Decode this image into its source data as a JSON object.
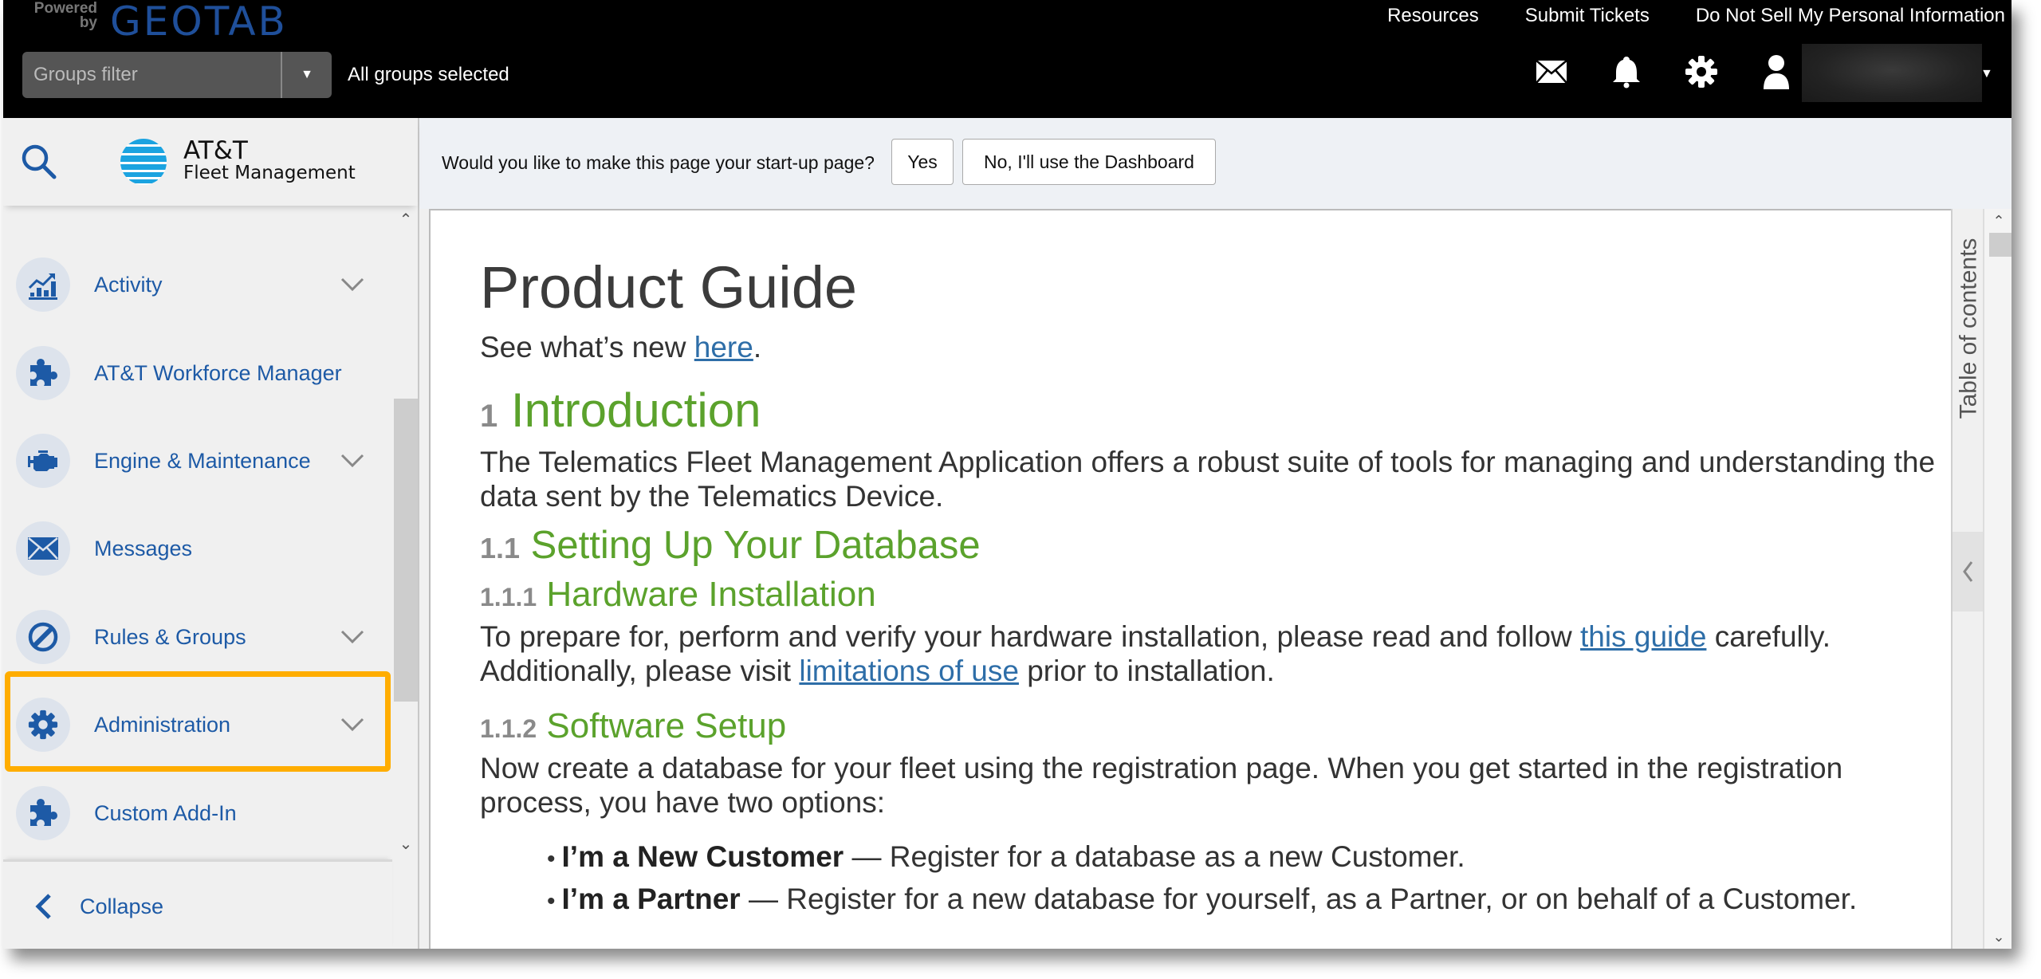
{
  "header": {
    "powered_by": [
      "Powered",
      "by"
    ],
    "brand": "GEOTAB",
    "top_links": [
      "Resources",
      "Submit Tickets",
      "Do Not Sell My Personal Information"
    ],
    "groups_filter": {
      "placeholder": "Groups filter",
      "value": ""
    },
    "groups_status": "All groups selected",
    "icons": [
      "mail-icon",
      "bell-icon",
      "gear-icon",
      "user-icon"
    ]
  },
  "sidebar": {
    "brand_line1": "AT&T",
    "brand_line2": "Fleet Management",
    "items": [
      {
        "label": "Activity",
        "icon": "chart-icon",
        "expandable": true
      },
      {
        "label": "AT&T Workforce Manager",
        "icon": "puzzle-icon",
        "expandable": false
      },
      {
        "label": "Engine & Maintenance",
        "icon": "engine-icon",
        "expandable": true
      },
      {
        "label": "Messages",
        "icon": "envelope-icon",
        "expandable": false
      },
      {
        "label": "Rules & Groups",
        "icon": "rules-icon",
        "expandable": true
      },
      {
        "label": "Administration",
        "icon": "gear-icon",
        "expandable": true,
        "highlighted": true
      },
      {
        "label": "Custom Add-In",
        "icon": "puzzle-icon",
        "expandable": false
      }
    ],
    "collapse_label": "Collapse"
  },
  "prompt": {
    "question": "Would you like to make this page your start-up page?",
    "yes": "Yes",
    "no": "No, I'll use the Dashboard"
  },
  "document": {
    "title": "Product Guide",
    "whats_new_prefix": "See what’s new ",
    "whats_new_link": "here",
    "whats_new_suffix": ".",
    "sections": {
      "intro_num": "1",
      "intro_title": "Introduction",
      "intro_text": "The Telematics Fleet Management Application offers a robust suite of tools for managing and understanding the data sent by the Telematics Device.",
      "db_num": "1.1",
      "db_title": "Setting Up Your Database",
      "hw_num": "1.1.1",
      "hw_title": "Hardware Installation",
      "hw_text1": "To prepare for, perform and verify your hardware installation, please read and follow ",
      "hw_link1": "this guide",
      "hw_text2": " carefully. Additionally, please visit ",
      "hw_link2": "limitations of use",
      "hw_text3": " prior to installation.",
      "sw_num": "1.1.2",
      "sw_title": "Software Setup",
      "sw_text": "Now create a database for your fleet using the registration page. When you get started in the registration process, you have two options:",
      "options": [
        {
          "bold": "I’m a New Customer",
          "text": " — Register for a database as a new Customer."
        },
        {
          "bold": "I’m a Partner",
          "text": " — Register for a new database for yourself, as a Partner, or on behalf of a Customer."
        }
      ]
    }
  },
  "toc": {
    "label": "Table of contents"
  },
  "colors": {
    "accent_blue": "#1d5aa6",
    "heading_green": "#5ba22c",
    "highlight": "#ffad00",
    "link": "#2e6ea8"
  }
}
